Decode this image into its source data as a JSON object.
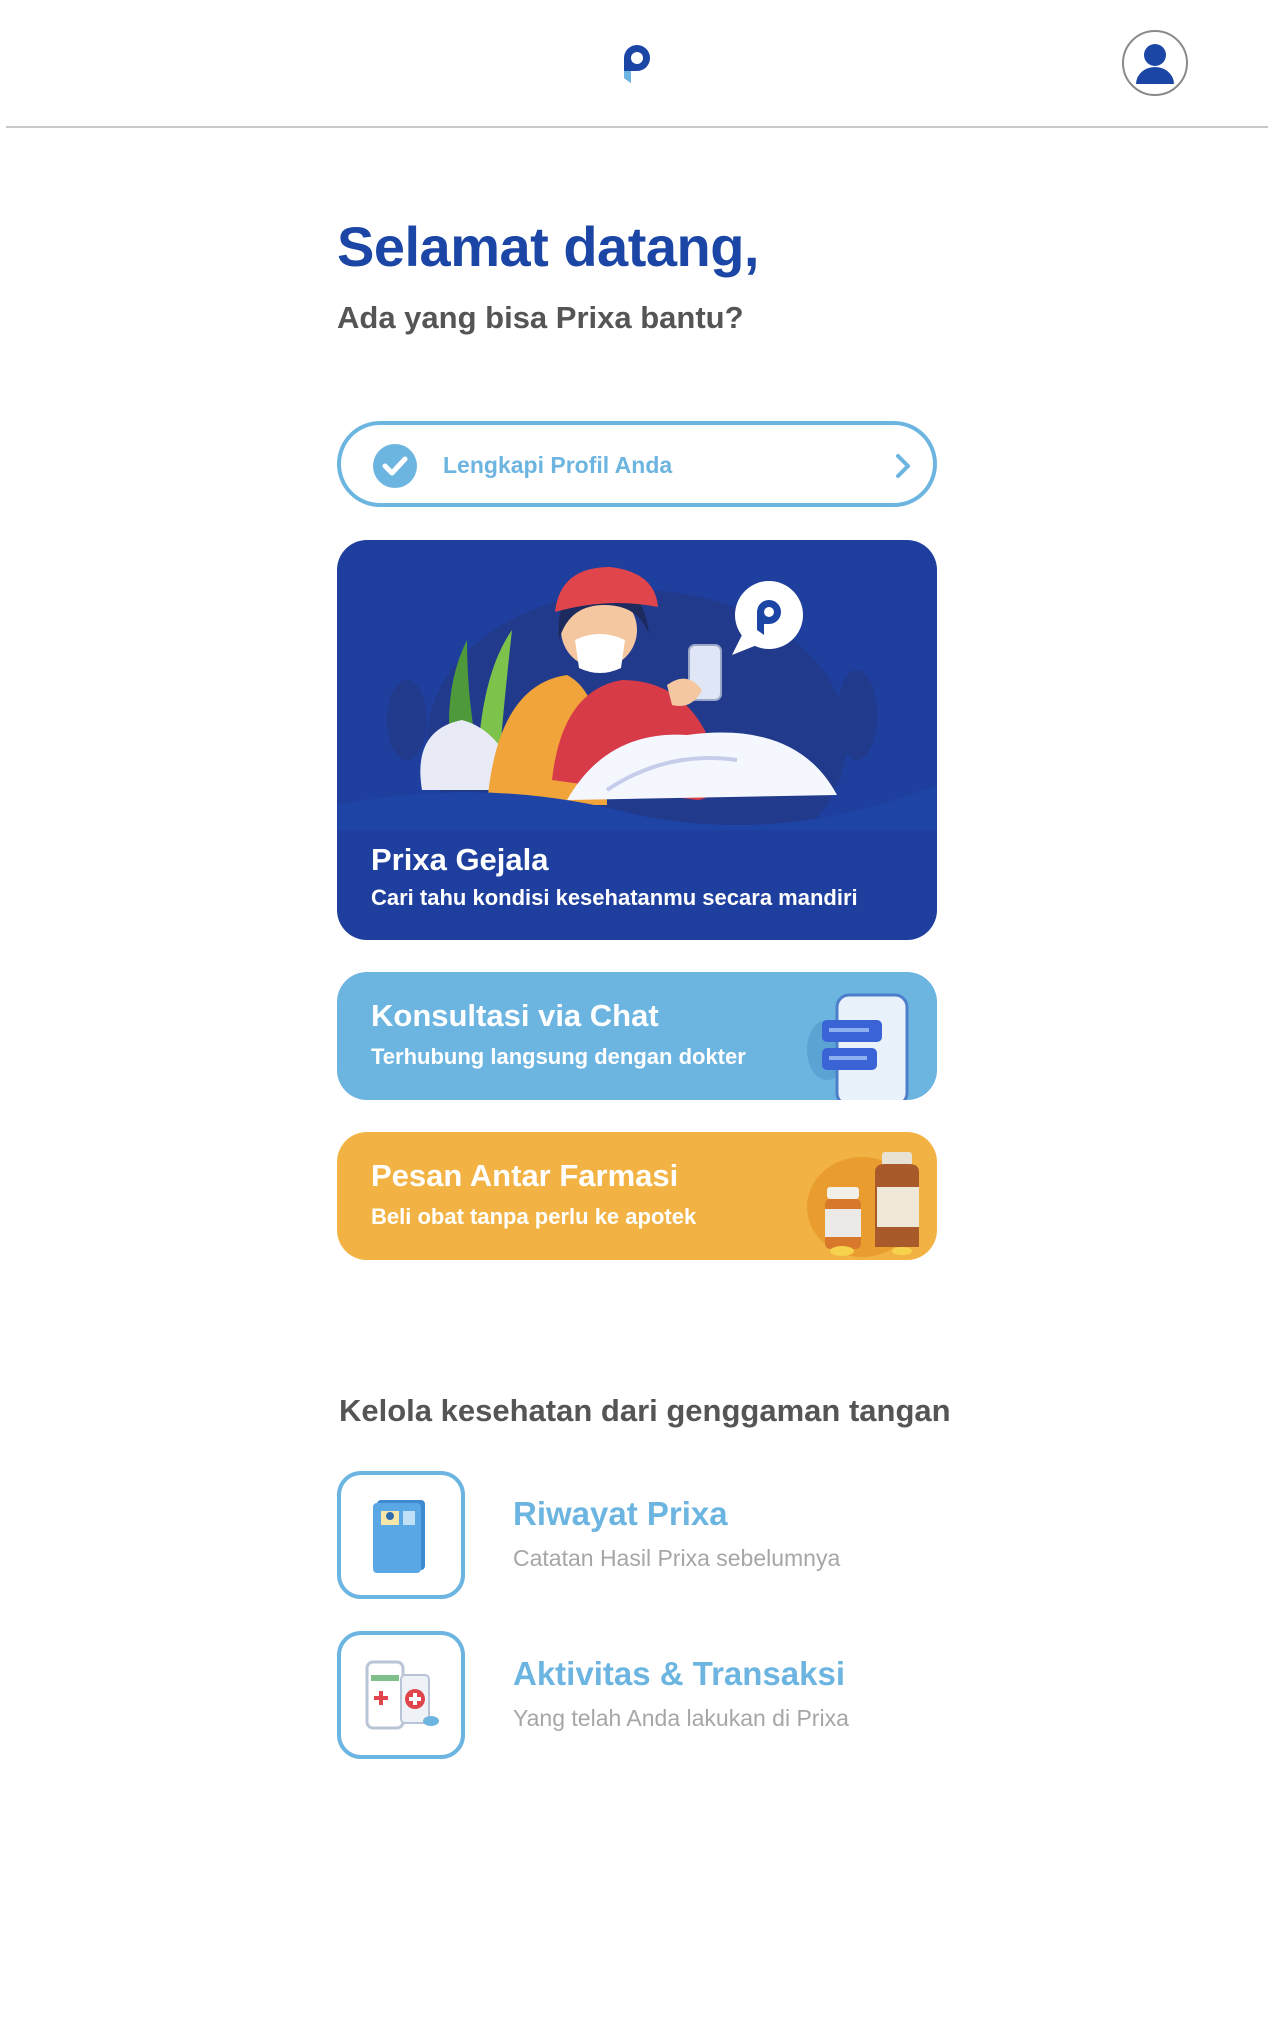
{
  "header": {
    "logo_icon": "prixa-logo-icon",
    "avatar_icon": "user-avatar-icon"
  },
  "welcome": {
    "title": "Selamat datang,",
    "subtitle": "Ada yang bisa Prixa bantu?"
  },
  "profile_prompt": {
    "label": "Lengkapi Profil Anda",
    "check_icon": "check-circle-icon",
    "chevron_icon": "chevron-right-icon"
  },
  "cards": [
    {
      "title": "Prixa Gejala",
      "description": "Cari tahu kondisi kesehatanmu secara mandiri",
      "color": "#1e3f9e",
      "illustration": "sick-person-with-phone-illustration"
    },
    {
      "title": "Konsultasi via Chat",
      "description": "Terhubung langsung dengan dokter",
      "color": "#6db5e1",
      "illustration": "phone-chat-illustration"
    },
    {
      "title": "Pesan Antar Farmasi",
      "description": "Beli obat tanpa perlu ke apotek",
      "color": "#f2b344",
      "illustration": "medicine-bottles-illustration"
    }
  ],
  "manage": {
    "title": "Kelola kesehatan dari genggaman tangan",
    "items": [
      {
        "title": "Riwayat Prixa",
        "description": "Catatan Hasil Prixa sebelumnya",
        "icon": "medical-record-book-icon"
      },
      {
        "title": "Aktivitas & Transaksi",
        "description": "Yang telah Anda lakukan di Prixa",
        "icon": "phone-transaction-icon"
      }
    ]
  },
  "colors": {
    "primary": "#1b46a5",
    "accent": "#6db5e1",
    "orange": "#f2b344",
    "text_dark": "#555555",
    "text_muted": "#a6a6a6"
  }
}
